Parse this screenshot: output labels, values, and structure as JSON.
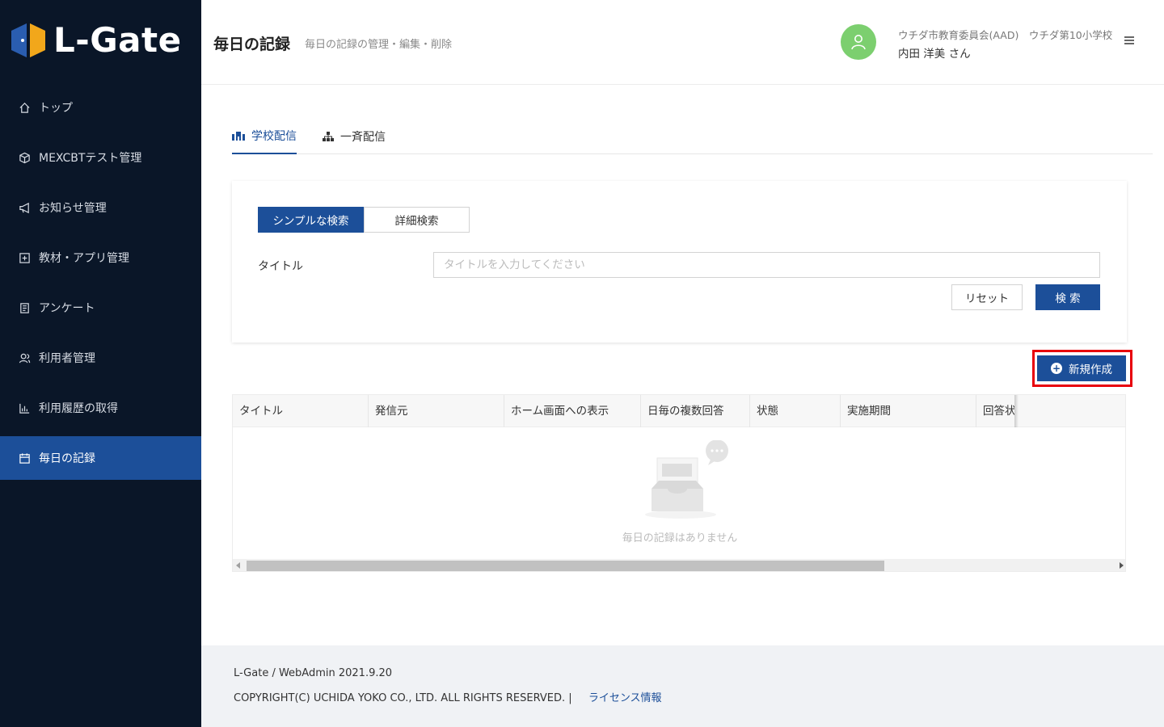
{
  "brand": {
    "name": "L-Gate",
    "accent": "#1c4f99",
    "sidebar_bg": "#0a1628"
  },
  "sidebar": {
    "items": [
      {
        "label": "トップ",
        "icon": "home-icon"
      },
      {
        "label": "MEXCBTテスト管理",
        "icon": "cube-icon"
      },
      {
        "label": "お知らせ管理",
        "icon": "megaphone-icon"
      },
      {
        "label": "教材・アプリ管理",
        "icon": "plus-square-icon"
      },
      {
        "label": "アンケート",
        "icon": "clipboard-icon"
      },
      {
        "label": "利用者管理",
        "icon": "users-icon"
      },
      {
        "label": "利用履歴の取得",
        "icon": "bar-chart-icon"
      },
      {
        "label": "毎日の記録",
        "icon": "calendar-icon",
        "active": true
      }
    ]
  },
  "header": {
    "title": "毎日の記録",
    "subtitle": "毎日の記録の管理・編集・削除",
    "org": "ウチダ市教育委員会(AAD)　ウチダ第10小学校",
    "user": "内田 洋美 さん"
  },
  "tabs": [
    {
      "label": "学校配信",
      "icon": "school-icon",
      "active": true
    },
    {
      "label": "一斉配信",
      "icon": "hierarchy-icon",
      "active": false
    }
  ],
  "search": {
    "mode_simple": "シンプルな検索",
    "mode_detail": "詳細検索",
    "title_label": "タイトル",
    "title_placeholder": "タイトルを入力してください",
    "title_value": "",
    "reset_label": "リセット",
    "search_label": "検 索"
  },
  "actions": {
    "new_label": "新規作成",
    "highlight_color": "#e8000b"
  },
  "table": {
    "columns": [
      "タイトル",
      "発信元",
      "ホーム画面への表示",
      "日毎の複数回答",
      "状態",
      "実施期間",
      "回答状"
    ],
    "rows": [],
    "empty_text": "毎日の記録はありません"
  },
  "footer": {
    "version": "L-Gate / WebAdmin 2021.9.20",
    "copyright": "COPYRIGHT(C) UCHIDA YOKO CO., LTD. ALL RIGHTS RESERVED. |",
    "license_link": "ライセンス情報"
  }
}
